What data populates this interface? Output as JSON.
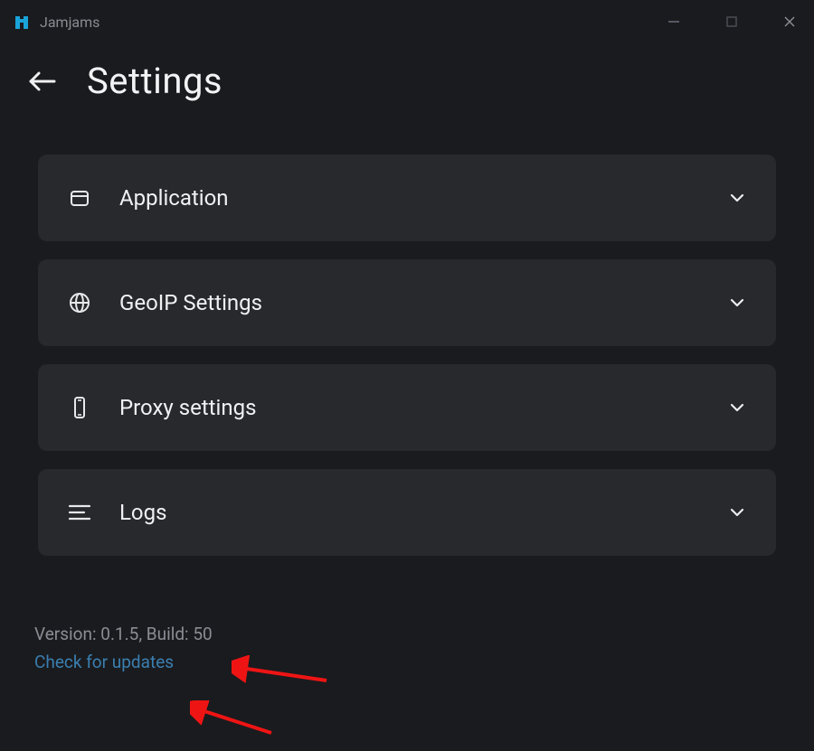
{
  "titlebar": {
    "app_name": "Jamjams"
  },
  "header": {
    "title": "Settings"
  },
  "sections": [
    {
      "id": "application",
      "label": "Application",
      "icon": "window-icon"
    },
    {
      "id": "geoip",
      "label": "GeoIP Settings",
      "icon": "globe-icon"
    },
    {
      "id": "proxy",
      "label": "Proxy settings",
      "icon": "phone-icon"
    },
    {
      "id": "logs",
      "label": "Logs",
      "icon": "logs-icon"
    }
  ],
  "footer": {
    "version_text": "Version: 0.1.5, Build: 50",
    "update_text": "Check for updates"
  }
}
